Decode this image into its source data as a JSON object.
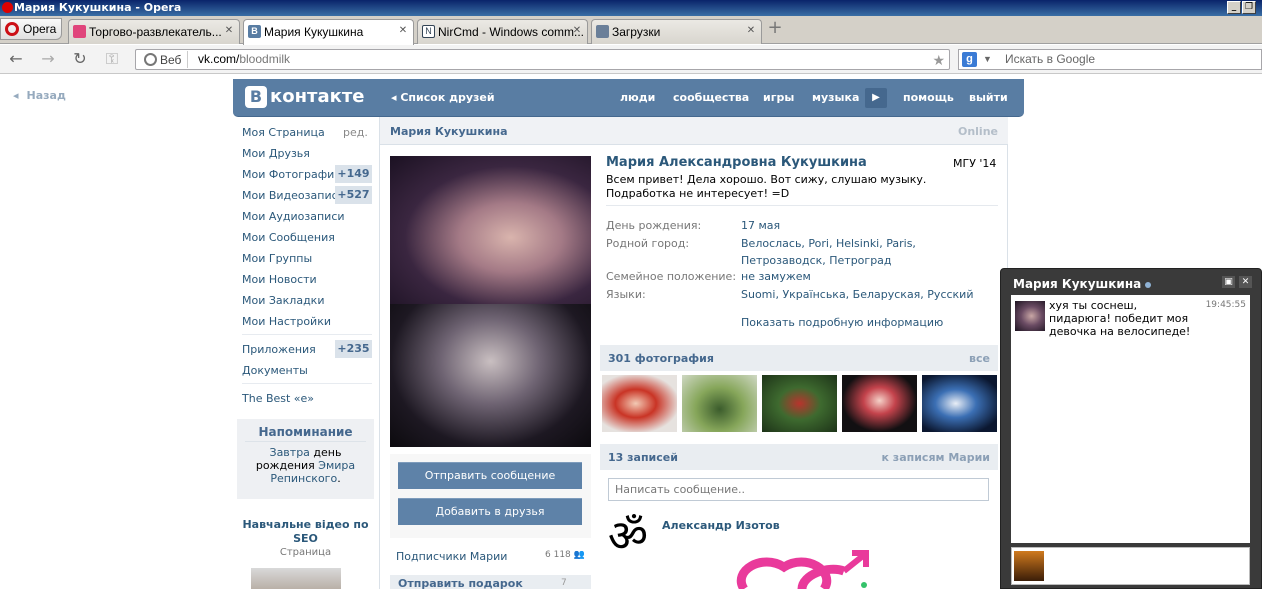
{
  "window": {
    "title": "Мария Кукушкина - Opera"
  },
  "browser": {
    "menu_label": "Opera",
    "tabs": [
      {
        "label": "Торгово-развлекатель...",
        "active": false
      },
      {
        "label": "Мария Кукушкина",
        "active": true
      },
      {
        "label": "NirCmd - Windows comm...",
        "active": false
      },
      {
        "label": "Загрузки",
        "active": false
      }
    ],
    "address": {
      "web_label": "Веб",
      "host": "vk.com/",
      "path": "bloodmilk"
    },
    "search_placeholder": "Искать в Google"
  },
  "page": {
    "back_label": "Назад",
    "header": {
      "logo": "контакте",
      "logo_letter": "В",
      "friends_list": "Список друзей",
      "nav": [
        "люди",
        "сообщества",
        "игры",
        "музыка",
        "помощь",
        "выйти"
      ]
    },
    "left_nav": {
      "items": [
        "Моя Страница",
        "Мои Друзья",
        "Мои Фотографии",
        "Мои Видеозаписи",
        "Мои Аудиозаписи",
        "Мои Сообщения",
        "Мои Группы",
        "Мои Новости",
        "Мои Закладки",
        "Мои Настройки"
      ],
      "edit": "ред.",
      "photos_badge": "+149",
      "videos_badge": "+527",
      "apps": "Приложения",
      "apps_badge": "+235",
      "docs": "Документы",
      "best": "The Best «e»"
    },
    "reminder": {
      "title": "Напоминание",
      "tomorrow": "Завтра",
      "text1": " день рождения ",
      "name": "Эмира Репинского",
      "text2": "."
    },
    "ad": {
      "title": "Навчальне відео по SEO",
      "subtitle": "Страница"
    },
    "profile": {
      "header_name": "Мария Кукушкина",
      "online": "Online",
      "full_name": "Мария Александровна Кукушкина",
      "university": "МГУ '14",
      "status": "Всем привет! Дела хорошо. Вот сижу, слушаю музыку. Подработка не интересует! =D",
      "birthday_label": "День рождения:",
      "birthday": "17 мая",
      "hometown_label": "Родной город:",
      "hometown": "Велослась, Pori, Helsinki, Paris, Петрозаводск, Петроград",
      "family_label": "Семейное положение:",
      "family": "не замужем",
      "lang_label": "Языки:",
      "languages": "Suomi, Українська, Беларуская, Русский",
      "more": "Показать подробную информацию",
      "send_message": "Отправить сообщение",
      "add_friend": "Добавить в друзья",
      "subscribers": "Подписчики Марии",
      "subscribers_count": "6 118",
      "gifts": "Отправить подарок",
      "gifts_count": "7",
      "photos_title": "301 фотография",
      "photos_all": "все",
      "wall_title": "13 записей",
      "wall_link": "к записям Марии",
      "wall_placeholder": "Написать сообщение..",
      "post_author": "Александр Изотов",
      "post_avatar_glyph": "ॐ"
    },
    "chat": {
      "title": "Мария Кукушкина",
      "message": "хуя ты соснеш, пидарюга! победит моя девочка на велосипеде!",
      "time": "19:45:55"
    }
  },
  "colors": {
    "vk_blue": "#597da3",
    "link": "#2b587a",
    "badge_bg": "#dae2ea"
  }
}
